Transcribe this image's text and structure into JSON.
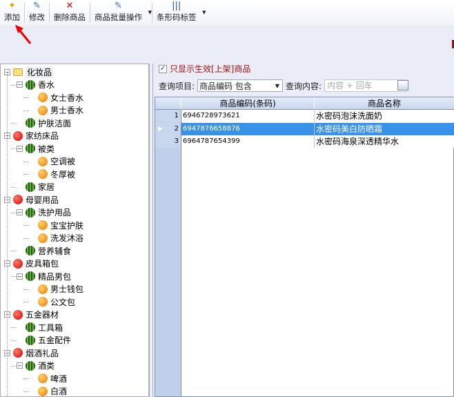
{
  "toolbar": [
    {
      "label": "添加",
      "icon": "add-icon",
      "dropdown": false
    },
    {
      "label": "修改",
      "icon": "edit-icon",
      "dropdown": false
    },
    {
      "label": "删除商品",
      "icon": "delete-icon",
      "dropdown": false
    },
    {
      "label": "商品批量操作",
      "icon": "batch-edit-icon",
      "dropdown": true
    },
    {
      "label": "条形码标签",
      "icon": "barcode-icon",
      "dropdown": true
    }
  ],
  "tree": [
    {
      "label": "化妆品",
      "level": 0,
      "icon": "folder",
      "expanded": true,
      "selected": true
    },
    {
      "label": "香水",
      "level": 1,
      "icon": "melon",
      "expanded": true
    },
    {
      "label": "女士香水",
      "level": 2,
      "icon": "orange"
    },
    {
      "label": "男士香水",
      "level": 2,
      "icon": "orange"
    },
    {
      "label": "护肤洁面",
      "level": 1,
      "icon": "melon"
    },
    {
      "label": "家纺床品",
      "level": 0,
      "icon": "apple",
      "expanded": true
    },
    {
      "label": "被类",
      "level": 1,
      "icon": "melon",
      "expanded": true
    },
    {
      "label": "空调被",
      "level": 2,
      "icon": "orange"
    },
    {
      "label": "冬厚被",
      "level": 2,
      "icon": "orange"
    },
    {
      "label": "家居",
      "level": 1,
      "icon": "melon"
    },
    {
      "label": "母婴用品",
      "level": 0,
      "icon": "apple",
      "expanded": true
    },
    {
      "label": "洗护用品",
      "level": 1,
      "icon": "melon",
      "expanded": true
    },
    {
      "label": "宝宝护肤",
      "level": 2,
      "icon": "orange"
    },
    {
      "label": "洗发沐浴",
      "level": 2,
      "icon": "orange"
    },
    {
      "label": "营养辅食",
      "level": 1,
      "icon": "melon"
    },
    {
      "label": "皮具箱包",
      "level": 0,
      "icon": "apple",
      "expanded": true
    },
    {
      "label": "精品男包",
      "level": 1,
      "icon": "melon",
      "expanded": true
    },
    {
      "label": "男士钱包",
      "level": 2,
      "icon": "orange"
    },
    {
      "label": "公文包",
      "level": 2,
      "icon": "orange"
    },
    {
      "label": "五金器材",
      "level": 0,
      "icon": "apple",
      "expanded": true
    },
    {
      "label": "工具箱",
      "level": 1,
      "icon": "melon"
    },
    {
      "label": "五金配件",
      "level": 1,
      "icon": "melon"
    },
    {
      "label": "烟酒礼品",
      "level": 0,
      "icon": "apple",
      "expanded": true
    },
    {
      "label": "酒类",
      "level": 1,
      "icon": "melon",
      "expanded": true
    },
    {
      "label": "啤酒",
      "level": 2,
      "icon": "orange"
    },
    {
      "label": "白酒",
      "level": 2,
      "icon": "orange"
    }
  ],
  "filter": {
    "label": "只显示生效[上架]商品",
    "checked": true
  },
  "query": {
    "item_label": "查询项目:",
    "item_value": "商品编码  包含",
    "content_label": "查询内容:",
    "content_placeholder": "内容 + 回车"
  },
  "grid": {
    "columns": [
      "商品编码(条码)",
      "商品名称"
    ],
    "rows": [
      {
        "no": "1",
        "code": "6946728973621",
        "name": "水密码泡沫洗面奶"
      },
      {
        "no": "2",
        "code": "6947876658876",
        "name": "水密码美白防晒霜",
        "selected": true
      },
      {
        "no": "3",
        "code": "6964787654399",
        "name": "水密码海泉深透精华水"
      }
    ]
  },
  "colors": {
    "selected_row": "#3a92e8",
    "filter_text": "#a01010",
    "row_header": "#c0d0ea"
  }
}
